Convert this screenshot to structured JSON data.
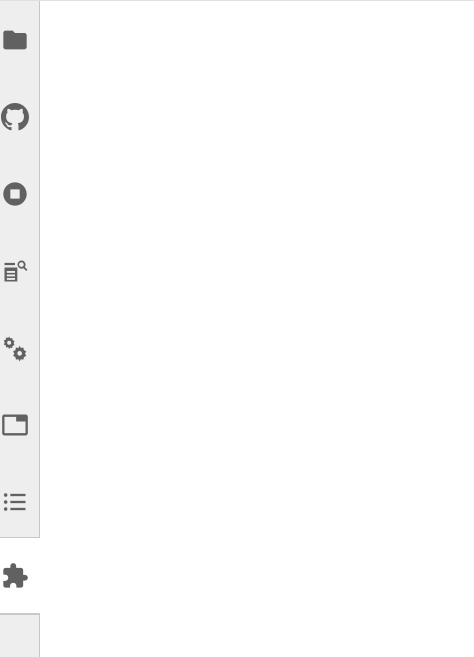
{
  "sidebar": {
    "tabs": [
      {
        "icon": "folder-icon",
        "label": ""
      },
      {
        "icon": "github-icon",
        "label": ""
      },
      {
        "icon": "stop-circle-icon",
        "label": ""
      },
      {
        "icon": "property-inspector-icon",
        "label": ""
      },
      {
        "icon": "gears-icon",
        "label": ""
      },
      {
        "icon": "window-tab-icon",
        "label": ""
      },
      {
        "icon": "list-icon",
        "label": ""
      },
      {
        "icon": "puzzle-extension-icon",
        "label": ""
      }
    ],
    "active_tab": "puzzle-extension-icon"
  },
  "colors": {
    "sidebar_bg": "#eeeeee",
    "icon": "#616161",
    "border": "#c8c8c8",
    "panel_bg": "#ffffff"
  }
}
